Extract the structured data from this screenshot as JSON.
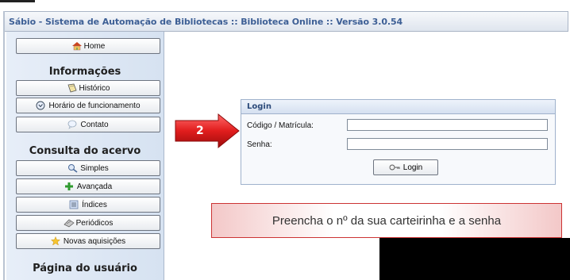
{
  "window": {
    "title": "Sábio - Sistema de Automação de Bibliotecas :: Biblioteca Online :: Versão 3.0.54"
  },
  "sidebar": {
    "home_label": "Home",
    "info_heading": "Informações",
    "info_items": [
      {
        "label": "Histórico",
        "icon": "book-icon"
      },
      {
        "label": "Horário de funcionamento",
        "icon": "clock-icon"
      },
      {
        "label": "Contato",
        "icon": "chat-icon"
      }
    ],
    "acervo_heading": "Consulta do acervo",
    "acervo_items": [
      {
        "label": "Simples",
        "icon": "magnifier-icon"
      },
      {
        "label": "Avançada",
        "icon": "plus-icon"
      },
      {
        "label": "Índices",
        "icon": "list-icon"
      },
      {
        "label": "Periódicos",
        "icon": "journal-icon"
      },
      {
        "label": "Novas aquisições",
        "icon": "star-icon"
      }
    ],
    "user_heading": "Página do usuário"
  },
  "login": {
    "panel_title": "Login",
    "code_label": "Código / Matrícula:",
    "password_label": "Senha:",
    "code_value": "",
    "password_value": "",
    "button_label": "Login"
  },
  "annotations": {
    "step_number": "2",
    "instruction": "Preencha o nº da sua carteirinha e a senha"
  }
}
